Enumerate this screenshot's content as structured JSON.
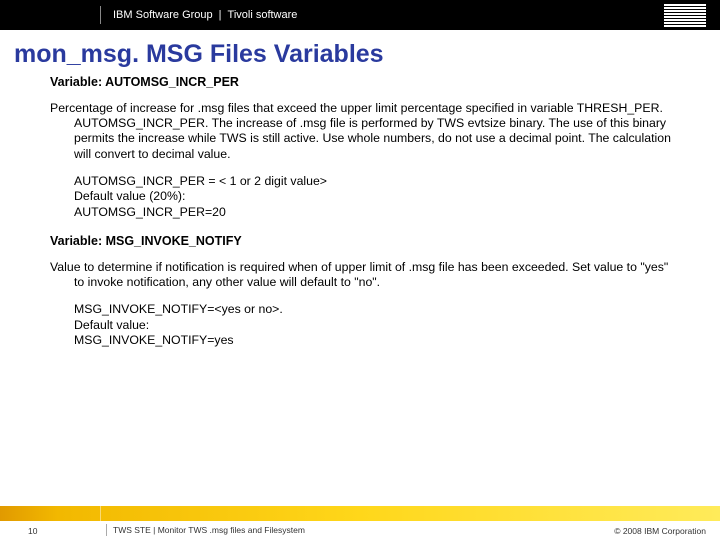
{
  "header": {
    "group": "IBM Software Group",
    "sep": "|",
    "product": "Tivoli software"
  },
  "title": "mon_msg. MSG Files Variables",
  "var1": {
    "label": "Variable: AUTOMSG_INCR_PER",
    "desc": "Percentage of increase for .msg files that exceed the upper limit percentage specified in variable THRESH_PER. AUTOMSG_INCR_PER. The increase of .msg file is performed by TWS evtsize binary. The use of this binary permits the increase while TWS is still active. Use whole numbers, do not use a decimal point. The calculation will convert to decimal value.",
    "code1": "AUTOMSG_INCR_PER = < 1 or 2 digit value>",
    "code2": "Default value (20%):",
    "code3": "AUTOMSG_INCR_PER=20"
  },
  "var2": {
    "label": "Variable: MSG_INVOKE_NOTIFY",
    "desc": "Value to determine if notification is required when of upper limit of .msg file has been exceeded. Set value to \"yes\" to invoke notification, any other value will default to \"no\".",
    "code1": "MSG_INVOKE_NOTIFY=<yes or no>.",
    "code2": "Default value:",
    "code3": "MSG_INVOKE_NOTIFY=yes"
  },
  "footer": {
    "page": "10",
    "center": "TWS STE | Monitor TWS .msg files and Filesystem",
    "copyright": "© 2008 IBM Corporation"
  }
}
